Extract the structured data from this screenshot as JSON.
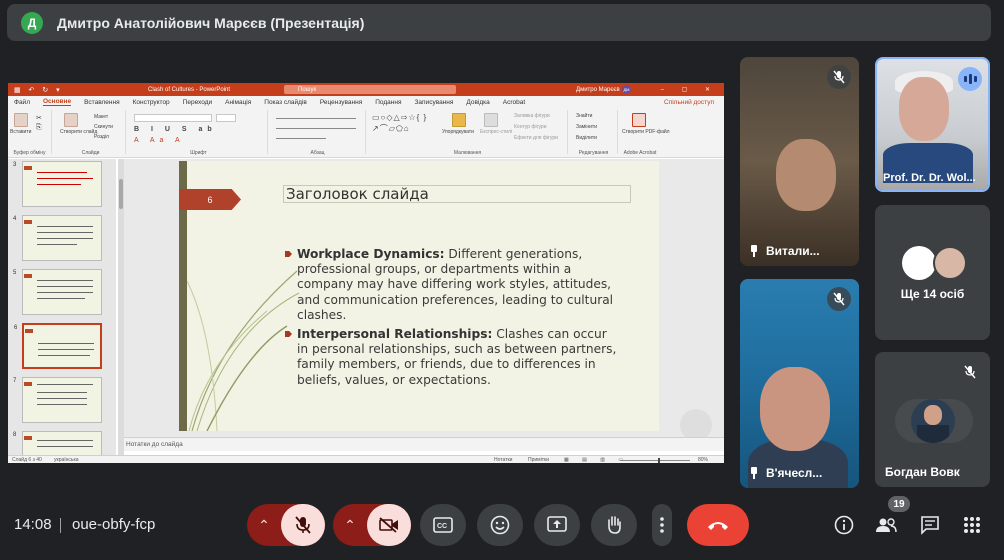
{
  "header": {
    "avatar_letter": "Д",
    "presenter_title": "Дмитро Анатолійович Марєєв (Презентація)"
  },
  "ppt": {
    "file_name": "Clash of Cultures  -  PowerPoint",
    "search_placeholder": "Пошук",
    "user_name": "Дмитро Марєєв",
    "user_initials": "ДМ",
    "menu": [
      "Файл",
      "Основне",
      "Вставлення",
      "Конструктор",
      "Переходи",
      "Анімація",
      "Показ слайдів",
      "Рецензування",
      "Подання",
      "Записування",
      "Довідка",
      "Acrobat"
    ],
    "menu_active_index": 1,
    "share_label": "Спільний доступ",
    "ribbon": {
      "clipboard_label": "Буфер обміну",
      "paste_label": "Вставити",
      "slides_label": "Слайди",
      "new_slide_label": "Створити слайд",
      "layout_label": "Макет",
      "reset_label": "Скинути",
      "section_label": "Розділ",
      "font_label": "Шрифт",
      "paragraph_label": "Абзац",
      "drawing_label": "Малювання",
      "arrange_label": "Упорядкувати",
      "quick_styles_label": "Експрес-стилі",
      "fill_label": "Заливка фігури",
      "outline_label": "Контур фігури",
      "effects_label": "Ефекти для фігури",
      "editing_label": "Редагування",
      "find_label": "Знайти",
      "replace_label": "Замінити",
      "select_label": "Виділити",
      "acrobat_label": "Adobe Acrobat",
      "pdf_label": "Створити PDF-файл"
    },
    "thumb_numbers": [
      "3",
      "4",
      "5",
      "6",
      "7",
      "8"
    ],
    "selected_thumb_index": 3,
    "slide": {
      "number": "6",
      "title": "Заголовок слайда",
      "bullets": [
        {
          "bold": "Workplace Dynamics:",
          "text": " Different generations, professional groups, or departments within a company may have differing work styles, attitudes, and communication preferences, leading to cultural clashes."
        },
        {
          "bold": "Interpersonal Relationships:",
          "text": " Clashes can occur in personal relationships, such as between partners, family members, or friends, due to differences in beliefs, values, or expectations."
        }
      ]
    },
    "notes_label": "Нотатки до слайда",
    "status": {
      "slide_counter": "Слайд 6 з 40",
      "language": "українська",
      "notes_btn": "Нотатки",
      "comments_btn": "Примітки",
      "zoom": "80%"
    }
  },
  "participants": [
    {
      "name": "Витали...",
      "muted": true,
      "pinned": true
    },
    {
      "name": "Prof. Dr. Dr. Wol...",
      "speaking": true
    },
    {
      "name": "В'ячесл...",
      "muted": true,
      "pinned": true
    },
    {
      "name": "Богдан Вовк",
      "muted": true
    }
  ],
  "more_participants": "Ще 14 осіб",
  "bottom": {
    "time": "14:08",
    "meeting_code": "oue-obfy-fcp",
    "people_count": "19"
  },
  "colors": {
    "background": "#202124",
    "tile": "#3c4043",
    "danger": "#8c1d18",
    "end_call": "#ea4335",
    "powerpoint": "#c43e1c",
    "speaking": "#8ab4f8"
  }
}
